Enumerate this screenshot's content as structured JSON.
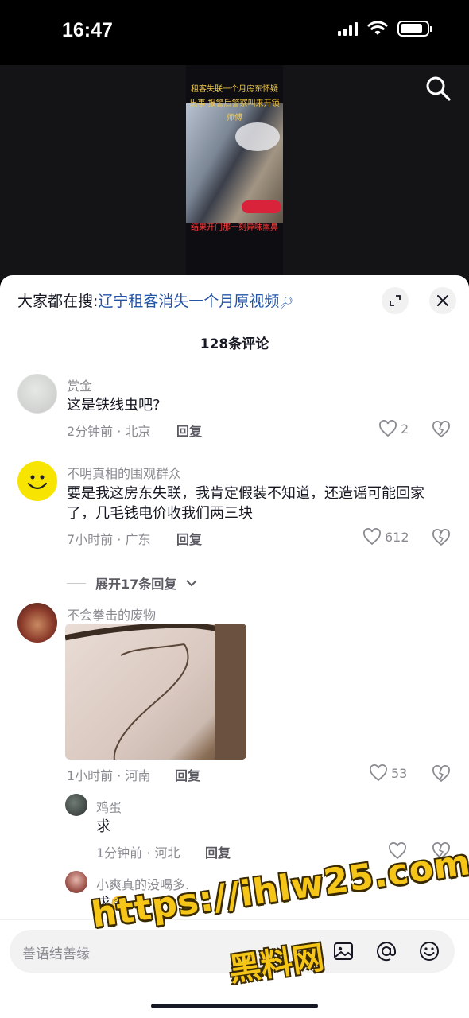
{
  "status_bar": {
    "time": "16:47"
  },
  "video": {
    "caption_top": "租客失联一个月房东怀疑出事 报警后警察叫来开锁师傅",
    "caption_bottom": "结果开门那一刻异味熏鼻",
    "search_icon": "search-icon"
  },
  "sheet": {
    "search_prefix": "大家都在搜:",
    "search_keyword": "辽宁租客消失一个月原视频",
    "comment_count": "128条评论",
    "expand_icon": "expand-icon",
    "close_icon": "close-icon"
  },
  "comments": [
    {
      "username": "赏金",
      "text": "这是铁线虫吧?",
      "time_location": "2分钟前 · 北京",
      "reply": "回复",
      "likes": "2"
    },
    {
      "username": "不明真相的围观群众",
      "text": "要是我这房东失联，我肯定假装不知道，还造谣可能回家了，几毛钱电价收我们两三块",
      "time_location": "7小时前 · 广东",
      "reply": "回复",
      "likes": "612",
      "expand_replies": "展开17条回复"
    },
    {
      "username": "不会拳击的废物",
      "text": "",
      "time_location": "1小时前 · 河南",
      "reply": "回复",
      "likes": "53",
      "replies": [
        {
          "username": "鸡蛋",
          "text": "求",
          "time_location": "1分钟前 · 河北",
          "reply": "回复",
          "likes": ""
        },
        {
          "username": "小爽真的没喝多.",
          "text": "求🥺"
        }
      ]
    }
  ],
  "input_bar": {
    "placeholder": "善语结善缘",
    "icons": [
      "image-icon",
      "mention-icon",
      "emoji-icon"
    ]
  },
  "watermark": {
    "url": "https://ihlw25.com",
    "name": "黑料网"
  },
  "colors": {
    "link_blue": "#2454a6",
    "muted_gray": "#8a8b91",
    "watermark_yellow": "#f5c518"
  }
}
